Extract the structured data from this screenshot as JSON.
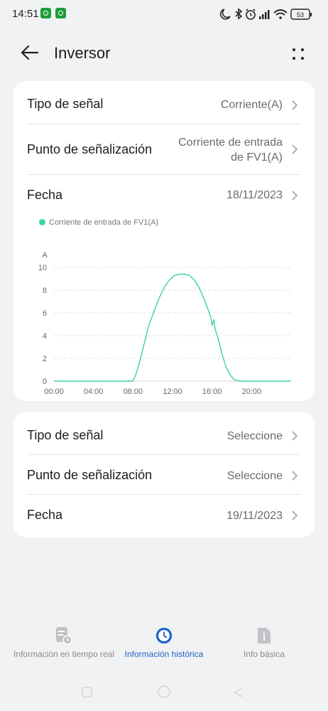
{
  "status": {
    "time": "14:51",
    "battery": "53"
  },
  "header": {
    "title": "Inversor"
  },
  "card1": {
    "rows": [
      {
        "label": "Tipo de señal",
        "value": "Corriente(A)"
      },
      {
        "label": "Punto de señalización",
        "value_line1": "Corriente de entrada",
        "value_line2": "de FV1(A)"
      },
      {
        "label": "Fecha",
        "value": "18/11/2023"
      }
    ],
    "legend": "Corriente de entrada de FV1(A)"
  },
  "card2": {
    "rows": [
      {
        "label": "Tipo de señal",
        "value": "Seleccione"
      },
      {
        "label": "Punto de señalización",
        "value": "Seleccione"
      },
      {
        "label": "Fecha",
        "value": "19/11/2023"
      }
    ]
  },
  "tabs": [
    {
      "label": "Información en tiempo real",
      "active": false
    },
    {
      "label": "Información histórica",
      "active": true
    },
    {
      "label": "Info básica",
      "active": false
    }
  ],
  "colors": {
    "series": "#3cd2a5",
    "active_tab": "#1d63c9"
  },
  "chart_data": {
    "type": "line",
    "ylabel": "A",
    "yticks": [
      0,
      2,
      4,
      6,
      8,
      10
    ],
    "ylim": [
      0,
      10
    ],
    "xticks": [
      "00:00",
      "04:00",
      "08:00",
      "12:00",
      "16:00",
      "20:00"
    ],
    "xlim": [
      0,
      24
    ],
    "grid": true,
    "legend_position": "top-left",
    "series": [
      {
        "name": "Corriente de entrada de FV1(A)",
        "color": "#3cd2a5",
        "x": [
          0,
          8,
          8.3,
          8.7,
          9.2,
          9.6,
          10.2,
          10.7,
          11.2,
          11.7,
          12.2,
          12.7,
          13.2,
          13.7,
          14.2,
          14.7,
          15.2,
          15.6,
          15.9,
          16.0,
          16.2,
          16.3,
          16.6,
          17.0,
          17.4,
          17.8,
          18.2,
          18.6,
          19,
          24
        ],
        "y": [
          0,
          0,
          0.6,
          1.8,
          3.5,
          4.9,
          6.3,
          7.4,
          8.3,
          8.9,
          9.3,
          9.4,
          9.4,
          9.3,
          8.9,
          8.2,
          7.2,
          6.3,
          5.5,
          4.9,
          5.4,
          4.6,
          3.8,
          2.4,
          1.3,
          0.6,
          0.15,
          0.03,
          0,
          0
        ]
      }
    ]
  }
}
